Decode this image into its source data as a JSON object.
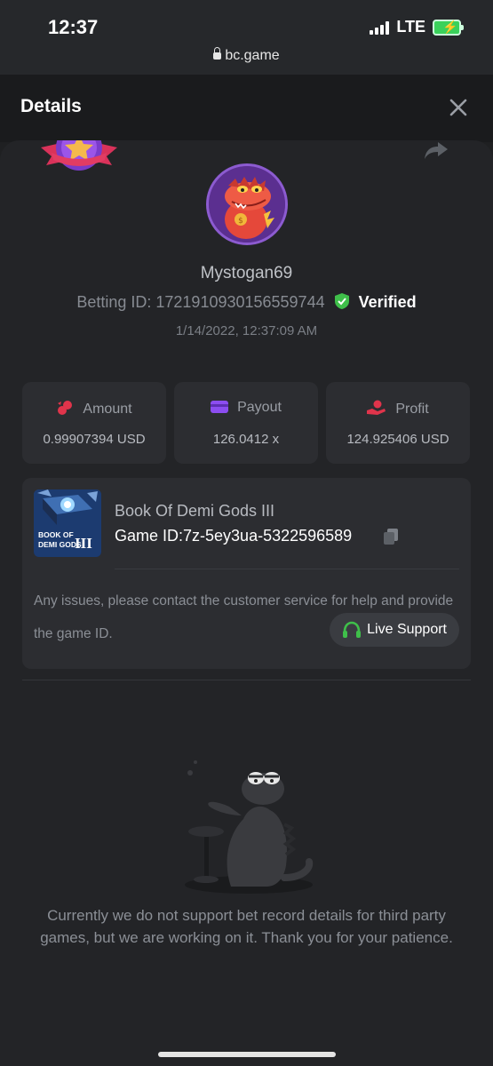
{
  "status_bar": {
    "time": "12:37",
    "network": "LTE",
    "url": "bc.game"
  },
  "header": {
    "title": "Details",
    "close_icon": "close-icon"
  },
  "profile": {
    "username": "Mystogan69",
    "betting_id_label": "Betting ID: 1721910930156559744",
    "verified_label": "Verified",
    "date": "1/14/2022, 12:37:09 AM"
  },
  "stats": [
    {
      "label": "Amount",
      "value": "0.99907394 USD",
      "icon": "coins-icon",
      "color": "#e0344b"
    },
    {
      "label": "Payout",
      "value": "126.0412 x",
      "icon": "wallet-icon",
      "color": "#8c4df0"
    },
    {
      "label": "Profit",
      "value": "124.925406 USD",
      "icon": "hand-coin-icon",
      "color": "#e0344b"
    }
  ],
  "game": {
    "name": "Book Of Demi Gods III",
    "game_id": "Game ID:7z-5ey3ua-5322596589",
    "thumb_text_line1": "BOOK OF",
    "thumb_text_line2": "DEMI GODS",
    "thumb_numeral": "III",
    "notice": "Any issues, please contact the customer service for help and provide the game ID.",
    "live_support_label": "Live Support"
  },
  "empty_state": {
    "message": "Currently we do not support bet record details for third party games, but we are working on it. Thank you for your patience."
  },
  "colors": {
    "accent_green": "#3fbf4a",
    "panel": "#232427",
    "card": "#2c2d31"
  }
}
